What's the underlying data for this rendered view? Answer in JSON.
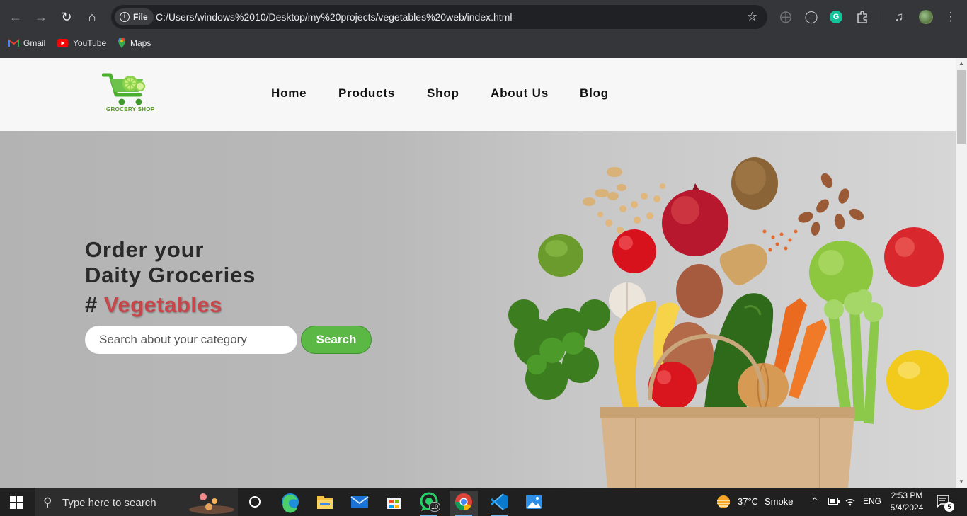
{
  "browser": {
    "omnibox": {
      "chip_label": "File",
      "url": "C:/Users/windows%2010/Desktop/my%20projects/vegetables%20web/index.html"
    },
    "bookmarks": [
      {
        "label": "Gmail",
        "icon": "gmail-icon"
      },
      {
        "label": "YouTube",
        "icon": "youtube-icon"
      },
      {
        "label": "Maps",
        "icon": "maps-icon"
      }
    ]
  },
  "site": {
    "logo_text": "GROCERY SHOP",
    "nav": [
      "Home",
      "Products",
      "Shop",
      "About Us",
      "Blog"
    ],
    "hero": {
      "title_line1": "Order your",
      "title_line2": "Daity Groceries",
      "tag_prefix": "#",
      "tag_accent": "Vegetables",
      "search_placeholder": "Search about your category",
      "search_button": "Search"
    },
    "colors": {
      "accent_green": "#5bb845",
      "accent_red": "#c8464a"
    }
  },
  "taskbar": {
    "search_placeholder": "Type here to search",
    "whatsapp_badge": "10",
    "weather": {
      "temp": "37°C",
      "condition": "Smoke"
    },
    "language": "ENG",
    "time": "2:53 PM",
    "date": "5/4/2024",
    "notification_count": "5"
  }
}
